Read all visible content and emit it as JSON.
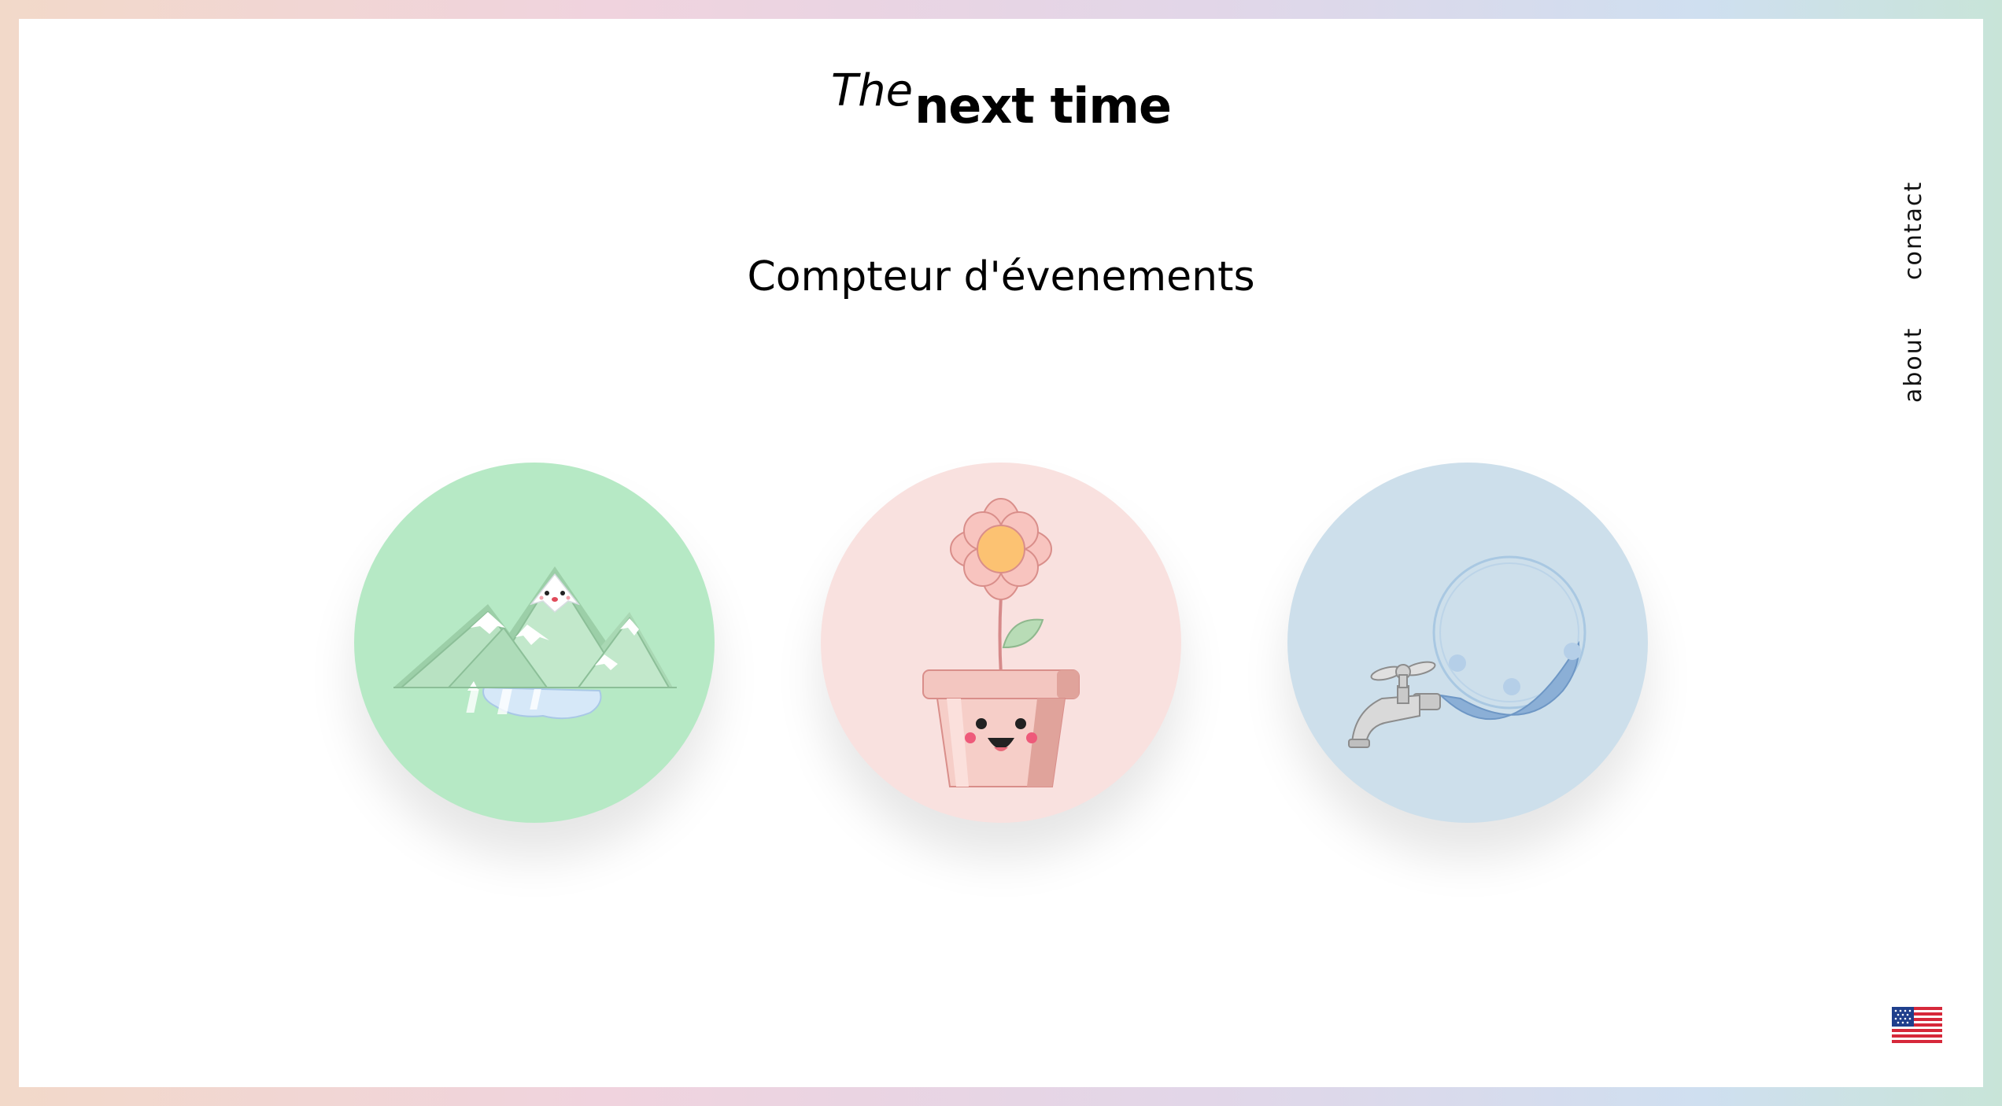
{
  "brand": {
    "prefix": "The",
    "name": "next time"
  },
  "page_title": "Compteur d'évenements",
  "nav": {
    "contact": "contact",
    "about": "about"
  },
  "cards": [
    {
      "icon": "mountain-lake-icon",
      "color": "#b6e9c5"
    },
    {
      "icon": "flower-pot-icon",
      "color": "#f9e1df"
    },
    {
      "icon": "water-tap-icon",
      "color": "#cddfeb"
    }
  ],
  "language": {
    "icon": "us-flag-icon"
  },
  "colors": {
    "background_gradient": [
      "#f2d9c9",
      "#f0d3de",
      "#e2d6e8",
      "#cfdff0",
      "#c8e4d8"
    ],
    "frame": "#ffffff",
    "text": "#000000"
  }
}
